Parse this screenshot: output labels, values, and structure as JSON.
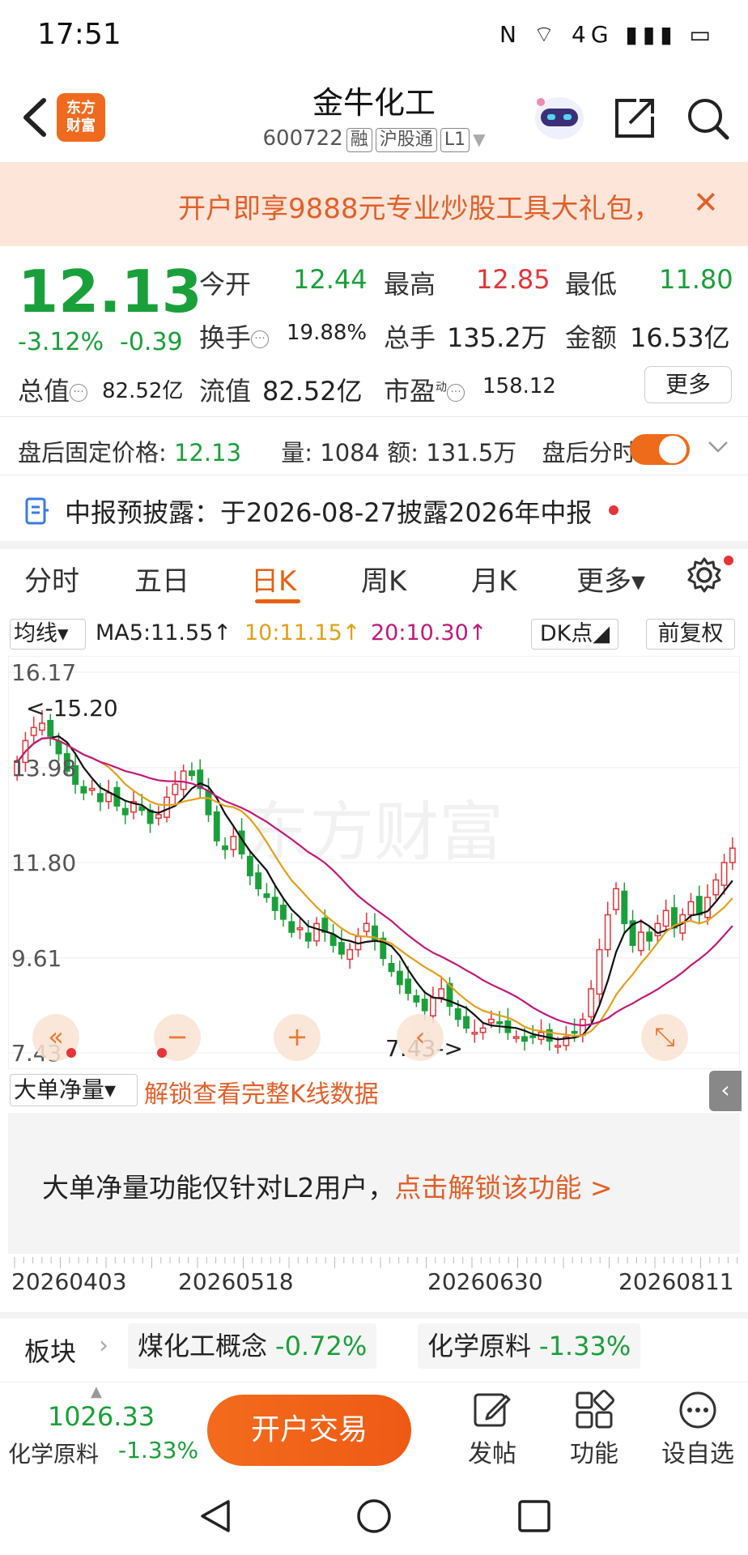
{
  "status_bar": {
    "time": "17:51",
    "icons": "N ⌔ 4G ▮▮▮ ▭"
  },
  "header": {
    "logo_line1": "东方",
    "logo_line2": "财富",
    "stock_name": "金牛化工",
    "stock_code": "600722",
    "tags": [
      "融",
      "沪股通",
      "L1"
    ]
  },
  "promo": {
    "text": "开户即享9888元专业炒股工具大礼包，",
    "close": "✕"
  },
  "quote": {
    "price": "12.13",
    "change_pct": "-3.12%",
    "change_amt": "-0.39",
    "open_label": "今开",
    "open": "12.44",
    "high_label": "最高",
    "high": "12.85",
    "low_label": "最低",
    "low": "11.80",
    "turnover_label": "换手",
    "turnover": "19.88%",
    "volume_label": "总手",
    "volume": "135.2万",
    "amount_label": "金额",
    "amount": "16.53亿",
    "mktcap_label": "总值",
    "mktcap": "82.52亿",
    "float_label": "流值",
    "float": "82.52亿",
    "pe_label": "市盈",
    "pe_sup": "动",
    "pe": "158.12",
    "more": "更多"
  },
  "after_hours": {
    "price_label": "盘后固定价格:",
    "price": "12.13",
    "vol_label": "量:",
    "vol": "1084",
    "amt_label": "额:",
    "amt": "131.5万",
    "timeshare_label": "盘后分时",
    "toggle_on": true
  },
  "report": {
    "text": "中报预披露：于2026-08-27披露2026年中报"
  },
  "chart_tabs": [
    "分时",
    "五日",
    "日K",
    "周K",
    "月K",
    "更多▾"
  ],
  "active_tab": "日K",
  "ma_row": {
    "select": "均线▾",
    "ma5": "MA5:11.55↑",
    "ma10": "10:11.15↑",
    "ma20": "20:10.30↑",
    "dk": "DK点◢",
    "adj": "前复权"
  },
  "chart_data": {
    "type": "candlestick",
    "y_ticks": [
      "16.17",
      "13.98",
      "11.80",
      "9.61",
      "7.43"
    ],
    "ylim": [
      7.43,
      16.17
    ],
    "annotations": {
      "max": "<-15.20",
      "min": "7.43->"
    },
    "watermark": "东方财富",
    "colors": {
      "up": "#e5343a",
      "down": "#1aa03a",
      "ma5": "#111111",
      "ma10": "#e2a019",
      "ma20": "#c0197a"
    },
    "closes": [
      14.1,
      14.6,
      14.9,
      15.0,
      14.7,
      14.3,
      13.9,
      13.6,
      13.4,
      13.5,
      13.2,
      13.4,
      13.1,
      12.9,
      13.2,
      13.0,
      12.7,
      12.9,
      13.3,
      13.6,
      13.9,
      13.8,
      13.5,
      12.9,
      12.3,
      12.1,
      12.4,
      12.0,
      11.5,
      11.2,
      11.0,
      10.7,
      10.5,
      10.2,
      10.3,
      10.0,
      10.4,
      10.2,
      9.9,
      9.7,
      9.8,
      10.1,
      10.4,
      10.0,
      9.6,
      9.3,
      9.0,
      8.8,
      8.6,
      8.4,
      8.7,
      8.9,
      8.5,
      8.2,
      8.0,
      7.9,
      8.0,
      8.2,
      8.1,
      7.9,
      7.8,
      7.7,
      7.8,
      7.9,
      7.7,
      7.6,
      7.8,
      7.9,
      8.2,
      8.9,
      9.8,
      10.6,
      11.2,
      10.4,
      9.9,
      10.2,
      10.0,
      10.4,
      10.7,
      10.3,
      10.6,
      10.9,
      10.6,
      11.0,
      11.4,
      11.8,
      12.13
    ],
    "controls": [
      "«",
      "−",
      "+",
      "‹",
      "⤡"
    ]
  },
  "indicator": {
    "select": "大单净量▾",
    "unlock_link": "解锁查看完整K线数据",
    "message": "大单净量功能仅针对L2用户，",
    "message_link": "点击解锁该功能 >"
  },
  "x_axis_dates": [
    "20260403",
    "20260518",
    "20260630",
    "20260811"
  ],
  "sectors": {
    "label": "板块",
    "items": [
      {
        "name": "煤化工概念",
        "change": "-0.72%"
      },
      {
        "name": "化学原料",
        "change": "-1.33%"
      }
    ]
  },
  "toolbar": {
    "index_value": "1026.33",
    "index_name": "化学原料",
    "index_change": "-1.33%",
    "trade_button": "开户交易",
    "post": "发帖",
    "functions": "功能",
    "custom": "设自选"
  }
}
